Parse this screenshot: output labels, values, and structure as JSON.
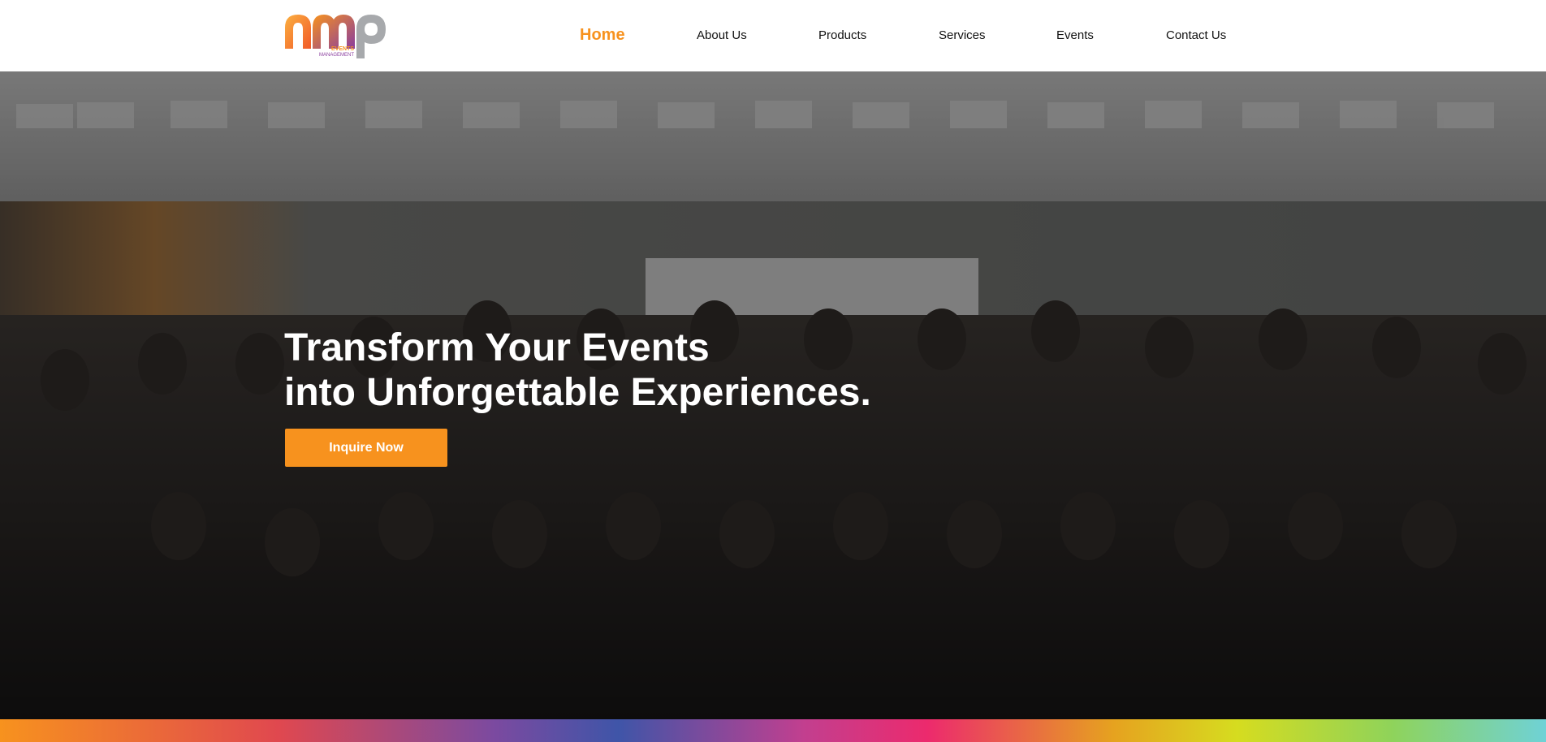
{
  "header": {
    "logo": {
      "letters": "nmp",
      "tagline_line1": "EVENTS",
      "tagline_line2": "MANAGEMENT",
      "colors": {
        "orange": "#f7921e",
        "purple": "#8a3d9e",
        "gray": "#a7a9ac"
      }
    },
    "nav": [
      {
        "label": "Home",
        "active": true
      },
      {
        "label": "About Us",
        "active": false
      },
      {
        "label": "Products",
        "active": false
      },
      {
        "label": "Services",
        "active": false
      },
      {
        "label": "Events",
        "active": false
      },
      {
        "label": "Contact Us",
        "active": false
      }
    ]
  },
  "hero": {
    "title_line1": "Transform Your Events",
    "title_line2": "into Unforgettable Experiences.",
    "cta_label": "Inquire Now",
    "background": "group-photo"
  },
  "colors": {
    "accent": "#f7921e",
    "nav_text": "#111111",
    "hero_text": "#ffffff"
  }
}
